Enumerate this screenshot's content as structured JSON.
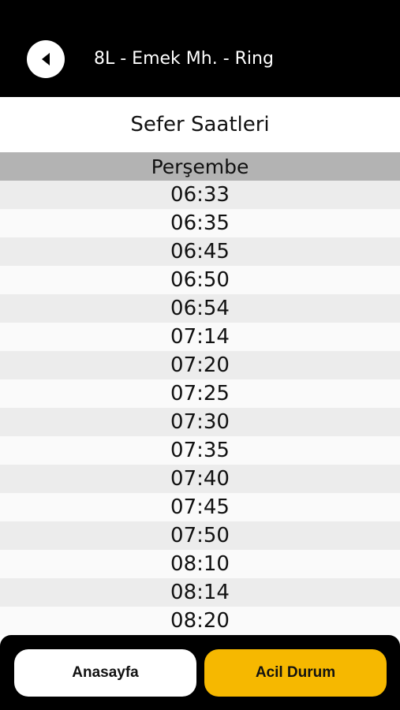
{
  "header": {
    "route_title": "8L - Emek Mh. - Ring",
    "back_icon": "back-arrow-icon",
    "background": "#000000"
  },
  "schedule": {
    "title": "Sefer Saatleri",
    "day": "Perşembe",
    "times": [
      "06:33",
      "06:35",
      "06:45",
      "06:50",
      "06:54",
      "07:14",
      "07:20",
      "07:25",
      "07:30",
      "07:35",
      "07:40",
      "07:45",
      "07:50",
      "08:10",
      "08:14",
      "08:20"
    ]
  },
  "footer": {
    "home_label": "Anasayfa",
    "emergency_label": "Acil Durum",
    "emergency_color": "#f6b800"
  }
}
